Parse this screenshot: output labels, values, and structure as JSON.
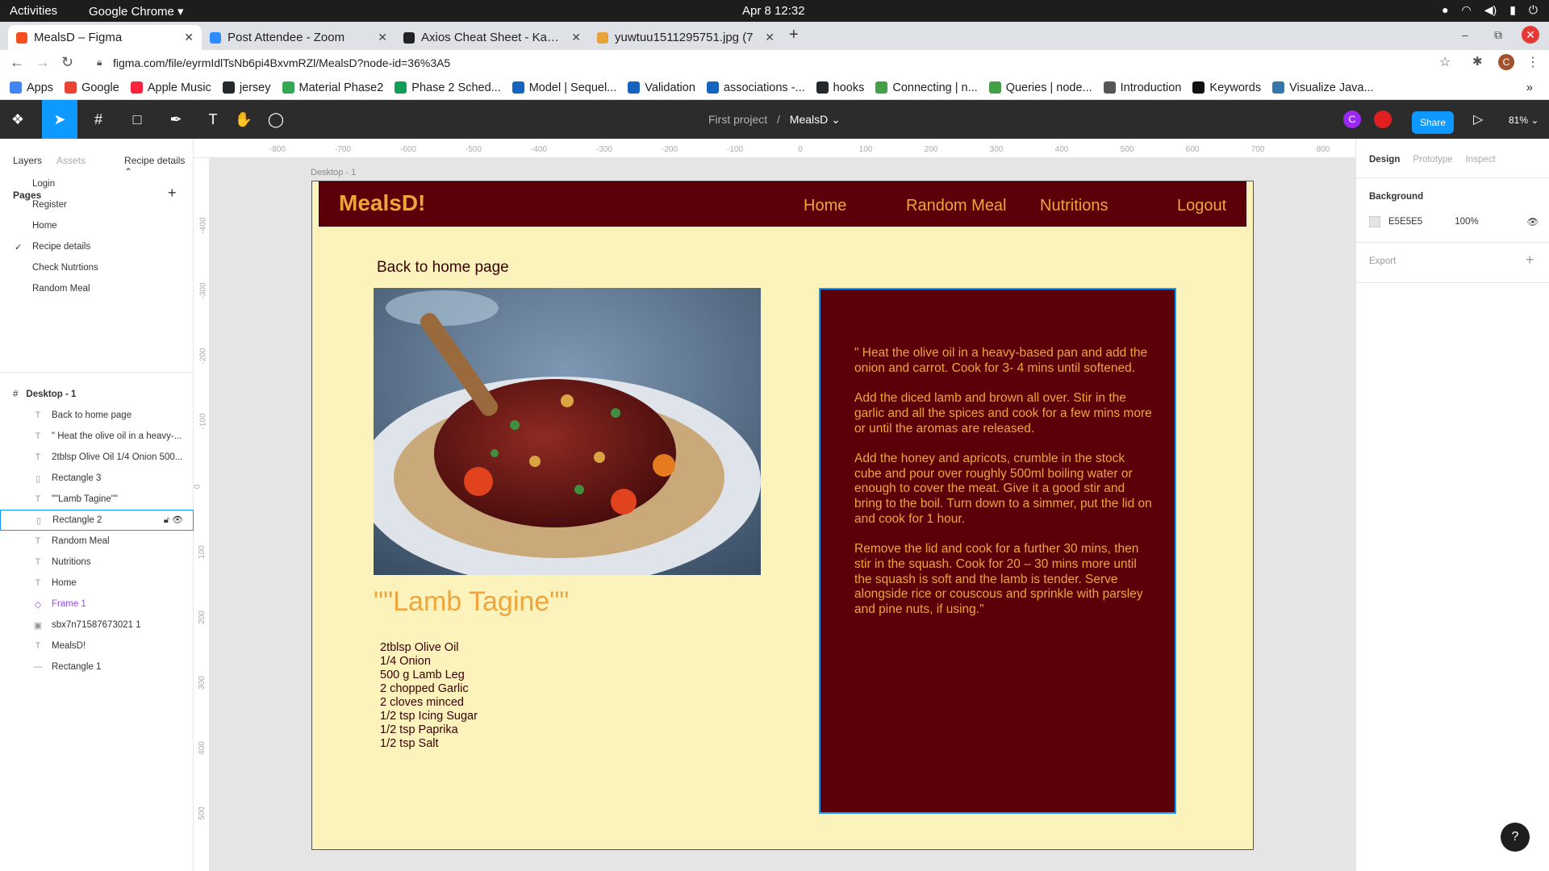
{
  "system_bar": {
    "activities": "Activities",
    "app": "Google Chrome ▾",
    "clock": "Apr 8  12:32"
  },
  "tabs": [
    {
      "title": "MealsD – Figma",
      "active": true,
      "color": "#f24e1e"
    },
    {
      "title": "Post Attendee - Zoom",
      "active": false,
      "color": "#2d8cff"
    },
    {
      "title": "Axios Cheat Sheet - Kapeli",
      "active": false,
      "color": "#222222"
    },
    {
      "title": "yuwtuu1511295751.jpg (7",
      "active": false,
      "color": "#e8a33c"
    }
  ],
  "url": "figma.com/file/eyrmIdlTsNb6pi4BxvmRZl/MealsD?node-id=36%3A5",
  "bookmarks": [
    {
      "label": "Apps",
      "color": "#4285f4"
    },
    {
      "label": "Google",
      "color": "#ea4335"
    },
    {
      "label": "Apple Music",
      "color": "#fa243c"
    },
    {
      "label": "jersey",
      "color": "#24292e"
    },
    {
      "label": "Material Phase2",
      "color": "#34a853"
    },
    {
      "label": "Phase 2 Sched...",
      "color": "#0f9d58"
    },
    {
      "label": "Model | Sequel...",
      "color": "#1565c0"
    },
    {
      "label": "Validation",
      "color": "#1565c0"
    },
    {
      "label": "associations -...",
      "color": "#1565c0"
    },
    {
      "label": "hooks",
      "color": "#24292e"
    },
    {
      "label": "Connecting | n...",
      "color": "#43a047"
    },
    {
      "label": "Queries | node...",
      "color": "#43a047"
    },
    {
      "label": "Introduction",
      "color": "#555555"
    },
    {
      "label": "Keywords",
      "color": "#111111"
    },
    {
      "label": "Visualize Java...",
      "color": "#3776ab"
    }
  ],
  "figma": {
    "crumb_project": "First project",
    "crumb_sep": "/",
    "crumb_file": "MealsD ⌄",
    "share": "Share",
    "zoom": "81% ⌄",
    "avatar_letter": "C"
  },
  "left_panel": {
    "tab_layers": "Layers",
    "tab_assets": "Assets",
    "tab_page": "Recipe details ⌃",
    "pages_header": "Pages",
    "pages": [
      "Login",
      "Register",
      "Home",
      "Recipe details",
      "Check Nutrtions",
      "Random Meal"
    ],
    "frame_name": "Desktop - 1",
    "layers": [
      {
        "name": "Back to home page",
        "icon": "T"
      },
      {
        "name": "\" Heat the olive oil in a heavy-...",
        "icon": "T"
      },
      {
        "name": "2tblsp Olive Oil 1/4 Onion 500...",
        "icon": "T"
      },
      {
        "name": "Rectangle 3",
        "icon": "▯"
      },
      {
        "name": "\"\"Lamb Tagine\"\"",
        "icon": "T"
      },
      {
        "name": "Rectangle 2",
        "icon": "▯"
      },
      {
        "name": "Random Meal",
        "icon": "T"
      },
      {
        "name": "Nutritions",
        "icon": "T"
      },
      {
        "name": "Home",
        "icon": "T"
      },
      {
        "name": "Frame 1",
        "icon": "◇"
      },
      {
        "name": "sbx7n71587673021 1",
        "icon": "▣"
      },
      {
        "name": "MealsD!",
        "icon": "T"
      },
      {
        "name": "Rectangle 1",
        "icon": "—"
      }
    ]
  },
  "ruler_top": [
    "-800",
    "-700",
    "-600",
    "-500",
    "-400",
    "-300",
    "-200",
    "-100",
    "0",
    "100",
    "200",
    "300",
    "400",
    "500",
    "600",
    "700",
    "800"
  ],
  "ruler_left": [
    "-400",
    "-300",
    "-200",
    "-100",
    "0",
    "100",
    "200",
    "300",
    "400",
    "500"
  ],
  "right_panel": {
    "tab_design": "Design",
    "tab_prototype": "Prototype",
    "tab_inspect": "Inspect",
    "background_label": "Background",
    "bg_hex": "E5E5E5",
    "bg_opacity": "100%",
    "export_label": "Export"
  },
  "canvas": {
    "frame_label": "Desktop - 1",
    "logo": "MealsD!",
    "nav": [
      "Home",
      "Random Meal",
      "Nutritions",
      "Logout"
    ],
    "back_link": "Back to home page",
    "recipe_title": "\"\"Lamb Tagine\"\"",
    "ingredients": [
      "2tblsp Olive Oil",
      "1/4 Onion",
      "500 g Lamb Leg",
      "2 chopped Garlic",
      "2 cloves minced",
      "1/2 tsp Icing Sugar",
      "1/2 tsp Paprika",
      "1/2 tsp Salt"
    ],
    "instructions": [
      "\" Heat the olive oil in a heavy-based pan and add the onion and carrot. Cook for 3- 4 mins until softened.",
      "Add the diced lamb and brown all over. Stir in the garlic and all the spices and cook for a few mins more or until the aromas are released.",
      "Add the honey and apricots, crumble in the stock cube and pour over roughly 500ml boiling water or enough to cover the meat. Give it a good stir and bring to the boil. Turn down to a simmer, put the lid on and cook for 1 hour.",
      "Remove the lid and cook for a further 30 mins, then stir in the squash. Cook for 20 – 30 mins more until the squash is soft and the lamb is tender. Serve alongside rice or couscous and sprinkle with parsley and pine nuts, if using.\""
    ]
  },
  "colors": {
    "nav_bg": "#5b0008",
    "accent": "#f0a53c",
    "frame_bg": "#fbf3bb",
    "figma_blue": "#0d99ff"
  }
}
